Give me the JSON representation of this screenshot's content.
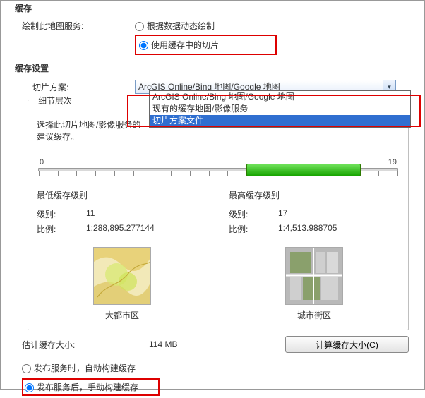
{
  "header": {
    "title": "缓存"
  },
  "draw": {
    "label": "绘制此地图服务:",
    "dynamic": "根据数据动态绘制",
    "cached": "使用缓存中的切片"
  },
  "cache_settings": {
    "title": "缓存设置"
  },
  "tiling": {
    "label": "切片方案:",
    "selected": "ArcGIS Online/Bing 地图/Google 地图",
    "options": [
      "ArcGIS Online/Bing 地图/Google 地图",
      "现有的缓存地图/影像服务",
      "切片方案文件"
    ]
  },
  "detail": {
    "title": "细节层次",
    "help": "选择此切片地图/影像服务的建议缓存。",
    "slider_min": "0",
    "slider_max": "19"
  },
  "min": {
    "title": "最低缓存级别",
    "level_k": "级别:",
    "level_v": "11",
    "scale_k": "比例:",
    "scale_v": "1:288,895.277144",
    "thumb": "大都市区"
  },
  "max": {
    "title": "最高缓存级别",
    "level_k": "级别:",
    "level_v": "17",
    "scale_k": "比例:",
    "scale_v": "1:4,513.988705",
    "thumb": "城市街区"
  },
  "est": {
    "label": "估计缓存大小:",
    "value": "114 MB",
    "calc": "计算缓存大小(C)"
  },
  "publish": {
    "auto": "发布服务时，自动构建缓存",
    "manual": "发布服务后，手动构建缓存"
  }
}
